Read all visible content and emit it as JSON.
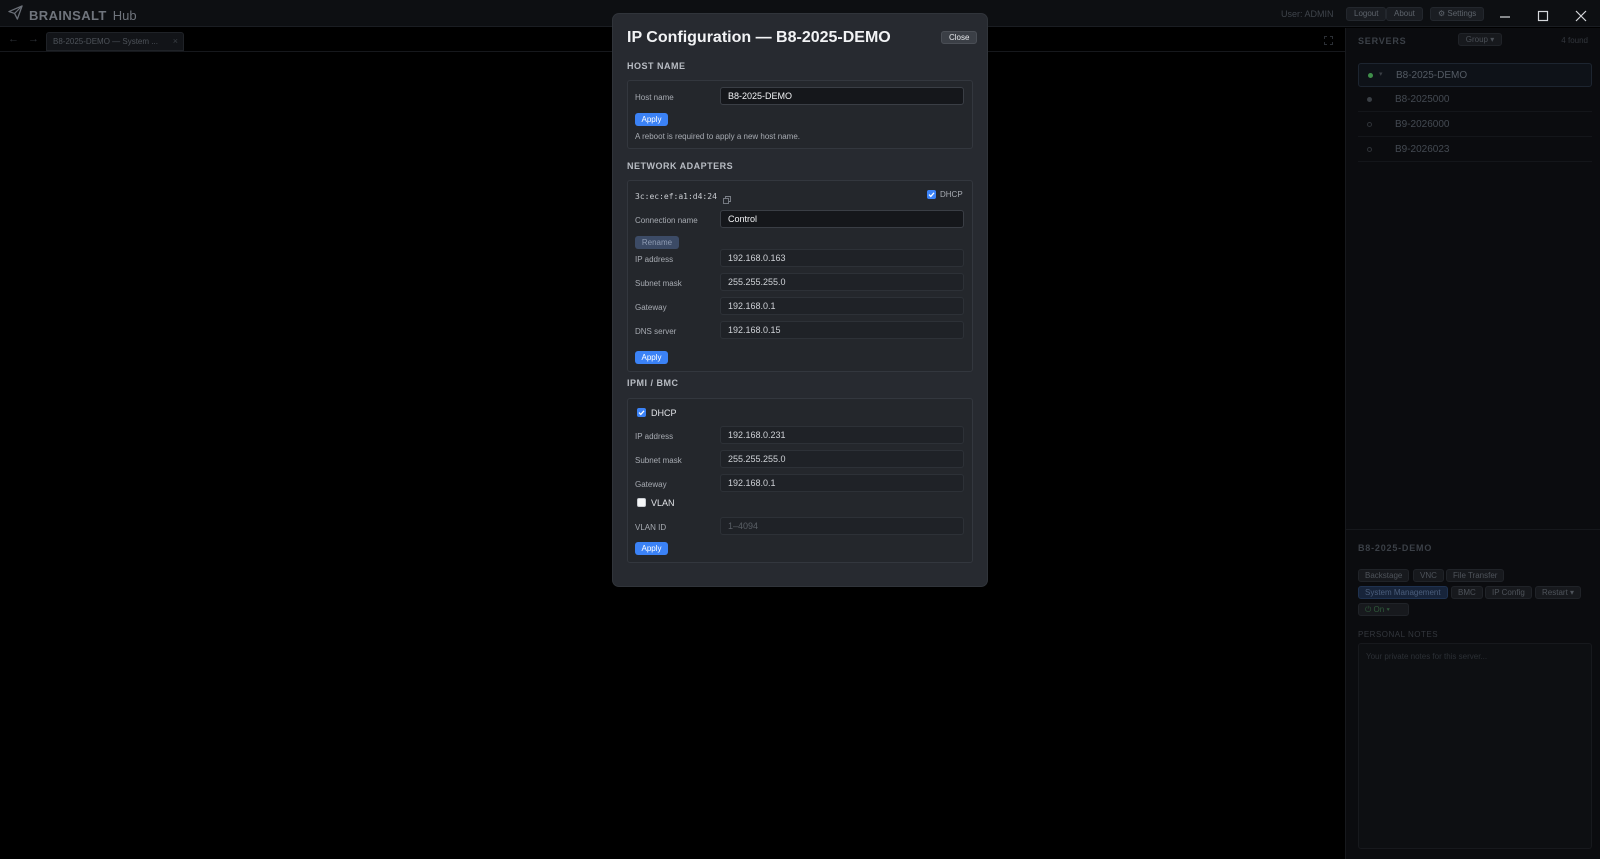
{
  "app": {
    "brand_name": "BRAINSALT",
    "brand_suffix": "Hub",
    "user_label": "User: ADMIN",
    "logout": "Logout",
    "about": "About",
    "settings": "⚙ Settings"
  },
  "tabs": [
    {
      "label": "B8-2025-DEMO — System ...",
      "close": "×"
    }
  ],
  "nav": {
    "back": "←",
    "forward": "→"
  },
  "sidebar": {
    "title": "SERVERS",
    "group_label": "Group ▾",
    "found": "4 found",
    "servers": [
      {
        "name": "B8-2025-DEMO",
        "status_color": "#3f8f4a",
        "selected": true
      },
      {
        "name": "B8-2025000",
        "status_color": "#3a3f45"
      },
      {
        "name": "B9-2026000",
        "status_color": "#2a2d32"
      },
      {
        "name": "B9-2026023",
        "status_color": "#2a2d32"
      }
    ],
    "detail_title": "B8-2025-DEMO",
    "actions_row1": [
      "Backstage",
      "VNC",
      "File Transfer"
    ],
    "actions_row2": [
      "System Management",
      "BMC",
      "IP Config",
      "Restart ▾"
    ],
    "power": "⏻ On ▾",
    "notes_label": "PERSONAL NOTES",
    "notes_placeholder": "Your private notes for this server..."
  },
  "modal": {
    "title": "IP Configuration — B8-2025-DEMO",
    "close": "Close",
    "host": {
      "heading": "HOST NAME",
      "label": "Host name",
      "value": "B8-2025-DEMO",
      "apply": "Apply",
      "note": "A reboot is required to apply a new host name."
    },
    "adapters": {
      "heading": "NETWORK ADAPTERS",
      "mac": "3c:ec:ef:a1:d4:24",
      "dhcp_label": "DHCP",
      "dhcp_checked": true,
      "conn_label": "Connection name",
      "conn_value": "Control",
      "rename": "Rename",
      "ip_label": "IP address",
      "ip_value": "192.168.0.163",
      "mask_label": "Subnet mask",
      "mask_value": "255.255.255.0",
      "gw_label": "Gateway",
      "gw_value": "192.168.0.1",
      "dns_label": "DNS server",
      "dns_value": "192.168.0.15",
      "apply": "Apply"
    },
    "ipmi": {
      "heading": "IPMI / BMC",
      "dhcp_label": "DHCP",
      "dhcp_checked": true,
      "ip_label": "IP address",
      "ip_value": "192.168.0.231",
      "mask_label": "Subnet mask",
      "mask_value": "255.255.255.0",
      "gw_label": "Gateway",
      "gw_value": "192.168.0.1",
      "vlan_label": "VLAN",
      "vlan_checked": false,
      "vlan_id_label": "VLAN ID",
      "vlan_id_placeholder": "1–4094",
      "apply": "Apply"
    }
  },
  "colors": {
    "accent": "#3b82f6",
    "modal_bg": "#272a30",
    "online": "#3f8f4a"
  }
}
